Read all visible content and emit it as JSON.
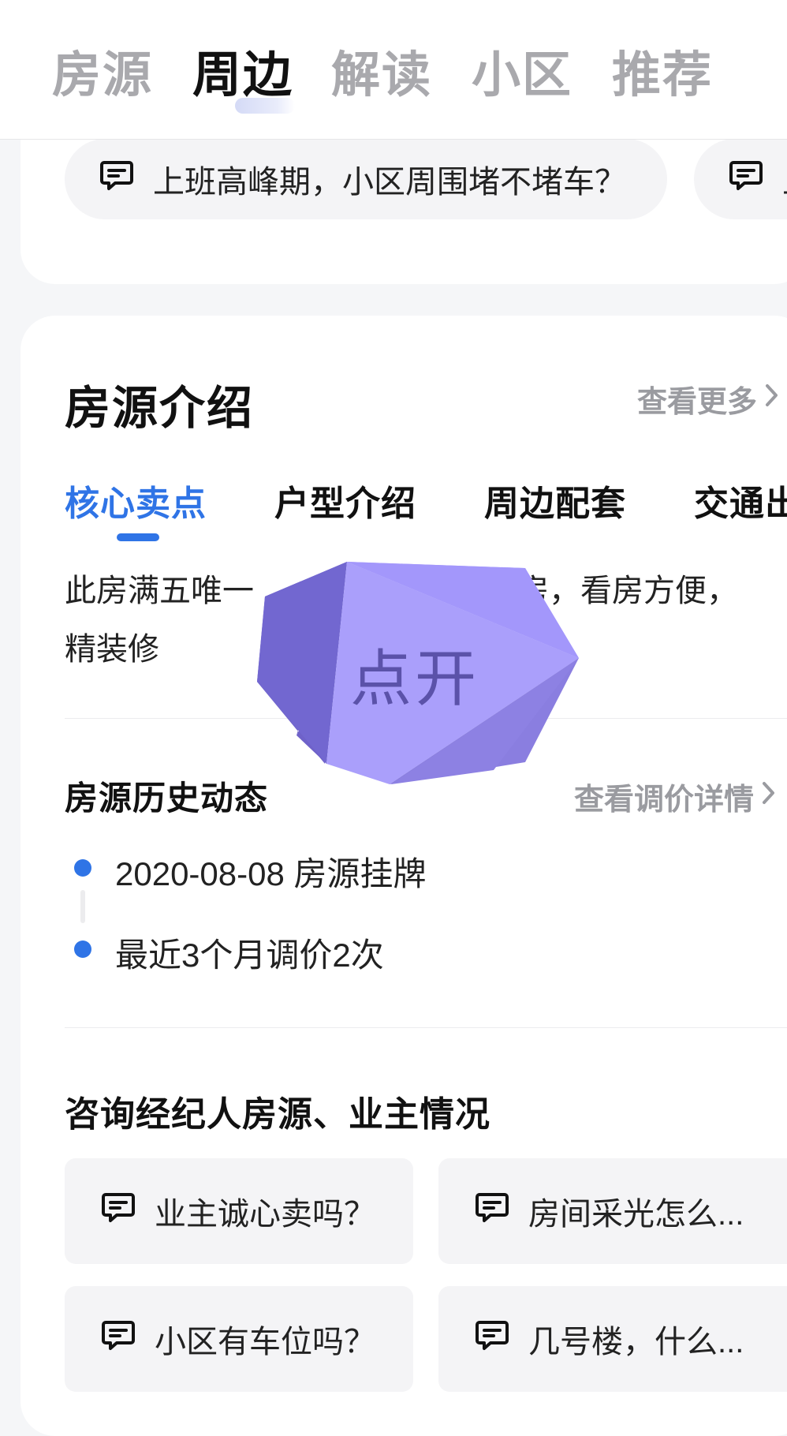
{
  "top_tabs": [
    {
      "label": "房源",
      "active": false
    },
    {
      "label": "周边",
      "active": true
    },
    {
      "label": "解读",
      "active": false
    },
    {
      "label": "小区",
      "active": false
    },
    {
      "label": "推荐",
      "active": false
    }
  ],
  "questions_row": [
    {
      "text": "上班高峰期，小区周围堵不堵车？",
      "icon": "chat-bubble-icon"
    },
    {
      "text": "上",
      "icon": "chat-bubble-icon"
    }
  ],
  "listing_intro": {
    "title": "房源介绍",
    "more_link": "查看更多",
    "sub_tabs": [
      {
        "label": "核心卖点",
        "active": true
      },
      {
        "label": "户型介绍",
        "active": false
      },
      {
        "label": "周边配套",
        "active": false
      },
      {
        "label": "交通出",
        "active": false
      }
    ],
    "description_line1_left": "此房满五唯一",
    "description_line1_right": "房，看房方便，",
    "description_line2": "精装修"
  },
  "history": {
    "title": "房源历史动态",
    "price_link": "查看调价详情",
    "events": [
      {
        "text": "2020-08-08 房源挂牌"
      },
      {
        "text": "最近3个月调价2次"
      }
    ]
  },
  "consult": {
    "title": "咨询经纪人房源、业主情况",
    "questions": [
      {
        "text": "业主诚心卖吗？",
        "icon": "chat-bubble-icon"
      },
      {
        "text": "房间采光怎么...",
        "icon": "chat-bubble-icon"
      },
      {
        "text": "小区有车位吗？",
        "icon": "chat-bubble-icon"
      },
      {
        "text": "几号楼，什么...",
        "icon": "chat-bubble-icon"
      }
    ]
  },
  "overlay": {
    "label": "点开",
    "colors": {
      "light": "#aaa0ff",
      "mid": "#8a7ee6",
      "dark": "#6f62c9"
    }
  },
  "colors": {
    "accent": "#2f74e6",
    "muted": "#9a9ba0",
    "background": "#f5f6f8"
  }
}
